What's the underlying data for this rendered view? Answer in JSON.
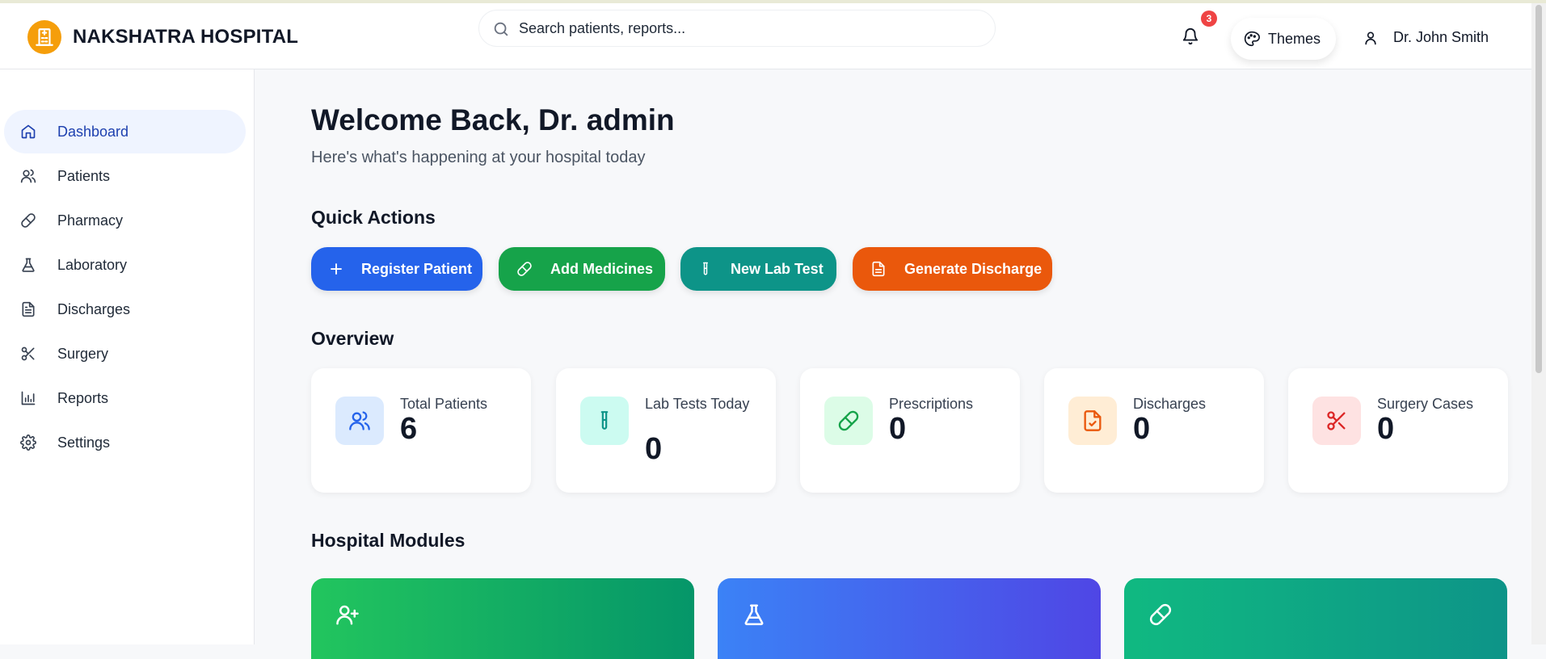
{
  "app": {
    "name": "NAKSHATRA HOSPITAL"
  },
  "search": {
    "placeholder": "Search patients, reports..."
  },
  "header": {
    "notification_count": "3",
    "themes_label": "Themes",
    "user_name": "Dr. John Smith"
  },
  "sidebar": {
    "items": [
      {
        "label": "Dashboard",
        "icon": "home-icon",
        "active": true
      },
      {
        "label": "Patients",
        "icon": "users-icon"
      },
      {
        "label": "Pharmacy",
        "icon": "pill-icon"
      },
      {
        "label": "Laboratory",
        "icon": "flask-icon"
      },
      {
        "label": "Discharges",
        "icon": "document-icon"
      },
      {
        "label": "Surgery",
        "icon": "scissors-icon"
      },
      {
        "label": "Reports",
        "icon": "bar-chart-icon"
      },
      {
        "label": "Settings",
        "icon": "gear-icon"
      }
    ]
  },
  "main": {
    "welcome": "Welcome Back, Dr. admin",
    "subtitle": "Here's what's happening at your hospital today",
    "quick_actions_title": "Quick Actions",
    "quick_actions": [
      {
        "label": "Register Patient",
        "icon": "plus-icon",
        "color": "#2563eb"
      },
      {
        "label": "Add Medicines",
        "icon": "pill-icon",
        "color": "#16a34a"
      },
      {
        "label": "New Lab Test",
        "icon": "test-tube-icon",
        "color": "#0d9488"
      },
      {
        "label": "Generate Discharge",
        "icon": "document-icon",
        "color": "#ea580c"
      }
    ],
    "overview_title": "Overview",
    "stats": [
      {
        "label": "Total Patients",
        "value": "6",
        "icon": "users-icon"
      },
      {
        "label": "Lab Tests Today",
        "value": "0",
        "icon": "test-tube-icon"
      },
      {
        "label": "Prescriptions",
        "value": "0",
        "icon": "pill-icon"
      },
      {
        "label": "Discharges",
        "value": "0",
        "icon": "file-check-icon"
      },
      {
        "label": "Surgery Cases",
        "value": "0",
        "icon": "scissors-icon"
      }
    ],
    "modules_title": "Hospital Modules",
    "modules": [
      {
        "icon": "user-plus-icon"
      },
      {
        "icon": "flask-icon"
      },
      {
        "icon": "pill-icon"
      }
    ]
  }
}
